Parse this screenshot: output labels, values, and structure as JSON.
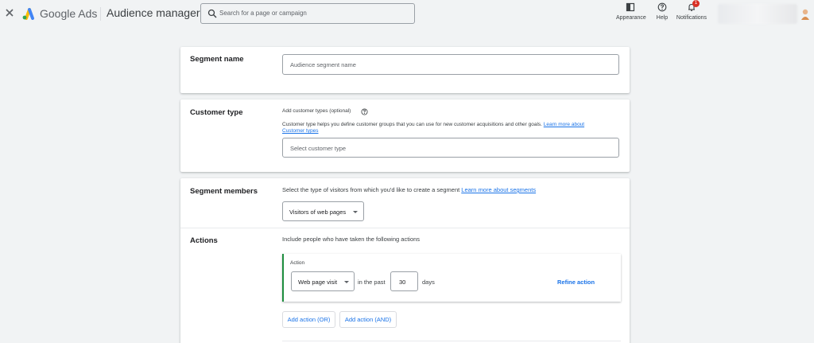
{
  "header": {
    "brand": "Google Ads",
    "page_title": "Audience manager",
    "search_placeholder": "Search for a page or campaign",
    "tools": {
      "appearance": "Appearance",
      "help": "Help",
      "notifications": "Notifications",
      "notifications_count": "1"
    }
  },
  "segment_name": {
    "label": "Segment name",
    "placeholder": "Audience segment name"
  },
  "customer_type": {
    "label": "Customer type",
    "add_label": "Add customer types (optional)",
    "description": "Customer type helps you define customer groups that you can use for new customer acquisitions and other goals.",
    "link_part1": "Learn more about",
    "link_part2": "Customer types",
    "select_placeholder": "Select customer type"
  },
  "segment_members": {
    "label": "Segment members",
    "description": "Select the type of visitors from which you'd like to create a segment",
    "link": "Learn more about segments",
    "dropdown_value": "Visitors of web pages"
  },
  "actions": {
    "label": "Actions",
    "description": "Include people who have taken the following actions",
    "action_heading": "Action",
    "action_value": "Web page visit",
    "in_the_past": "in the past",
    "days_value": "30",
    "days_label": "days",
    "refine": "Refine action",
    "add_or": "Add action (OR)",
    "add_and": "Add action (AND)"
  },
  "colors": {
    "accent": "#1a73e8",
    "action_border": "#1e8e3e",
    "badge": "#d93025"
  },
  "icons": [
    "close-icon",
    "google-ads-logo",
    "search-icon",
    "appearance-icon",
    "help-icon",
    "notifications-icon",
    "avatar"
  ]
}
